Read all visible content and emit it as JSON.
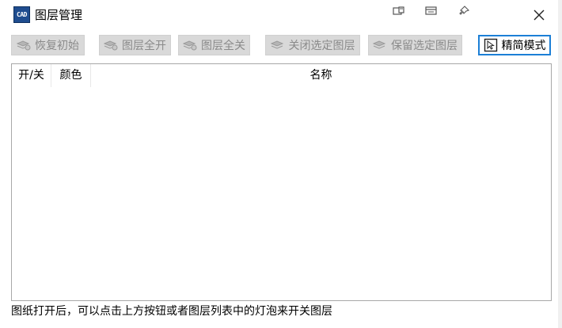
{
  "window": {
    "title": "图层管理",
    "app_icon_text": "CAD",
    "title_icons": [
      "restore-window-icon",
      "minimize-window-icon",
      "pin-icon",
      "close-icon"
    ]
  },
  "toolbar": {
    "buttons": [
      {
        "label": "恢复初始",
        "icon": "layers-icon",
        "enabled": false
      },
      {
        "label": "图层全开",
        "icon": "layers-icon",
        "enabled": false
      },
      {
        "label": "图层全关",
        "icon": "layers-icon",
        "enabled": false
      },
      {
        "label": "关闭选定图层",
        "icon": "layers-icon",
        "enabled": false
      },
      {
        "label": "保留选定图层",
        "icon": "layers-icon",
        "enabled": false
      },
      {
        "label": "精简模式",
        "icon": "compact-mode-icon",
        "enabled": true
      }
    ]
  },
  "list": {
    "columns": [
      "开/关",
      "颜色",
      "名称"
    ],
    "rows": []
  },
  "status": {
    "text": "图纸打开后，可以点击上方按钮或者图层列表中的灯泡来开关图层"
  },
  "colors": {
    "accent": "#1c7fd6",
    "disabled_button_bg": "#d9d9d9",
    "disabled_text": "#8a8a8a",
    "panel_border": "#a8a8a8"
  }
}
